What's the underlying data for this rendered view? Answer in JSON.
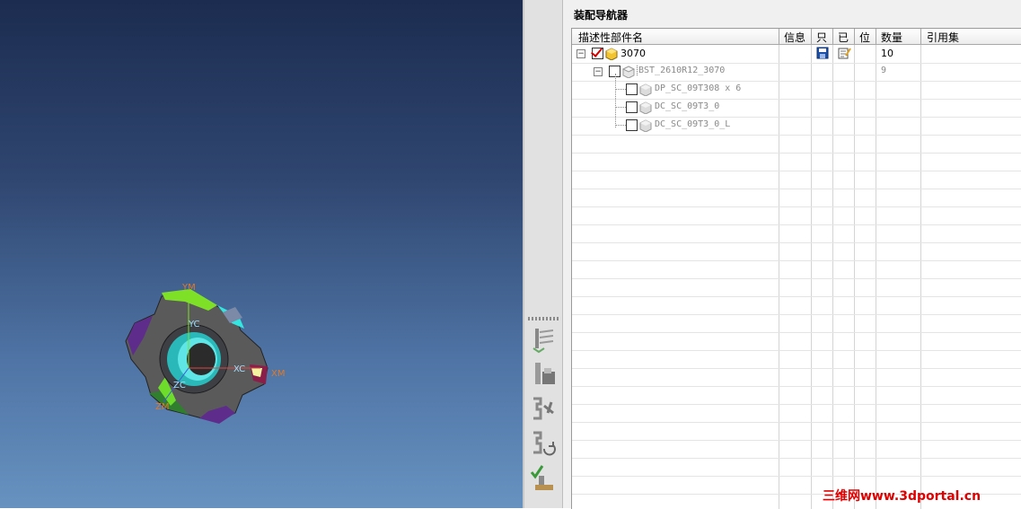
{
  "viewport": {
    "axes": {
      "ym": "YM",
      "yc": "YC",
      "xc": "XC",
      "xm": "XM",
      "zc": "ZC",
      "zm": "ZM"
    }
  },
  "resource_bar": {
    "buttons": [
      "assembly-navigator-icon",
      "constraint-navigator-icon",
      "part-navigator-icon",
      "reuse-library-icon",
      "hd3d-tools-icon"
    ]
  },
  "navigator": {
    "title": "装配导航器",
    "columns": {
      "name": "描述性部件名",
      "info": "信息",
      "readonly": "只",
      "modified": "已",
      "position": "位",
      "quantity": "数量",
      "reference_set": "引用集"
    },
    "rows": [
      {
        "name": "3070",
        "quantity": "10",
        "checked": true,
        "level": 0
      },
      {
        "name": "BST_2610R12_3070",
        "quantity": "9",
        "checked": false,
        "level": 1
      },
      {
        "name": "DP_SC_09T308 x 6",
        "quantity": "",
        "checked": false,
        "level": 2
      },
      {
        "name": "DC_SC_09T3_0",
        "quantity": "",
        "checked": false,
        "level": 2
      },
      {
        "name": "DC_SC_09T3_0_L",
        "quantity": "",
        "checked": false,
        "level": 2
      }
    ]
  },
  "watermark": "三维网www.3dportal.cn",
  "colors": {
    "accent_check": "#d40000",
    "watermark": "#e00000"
  }
}
